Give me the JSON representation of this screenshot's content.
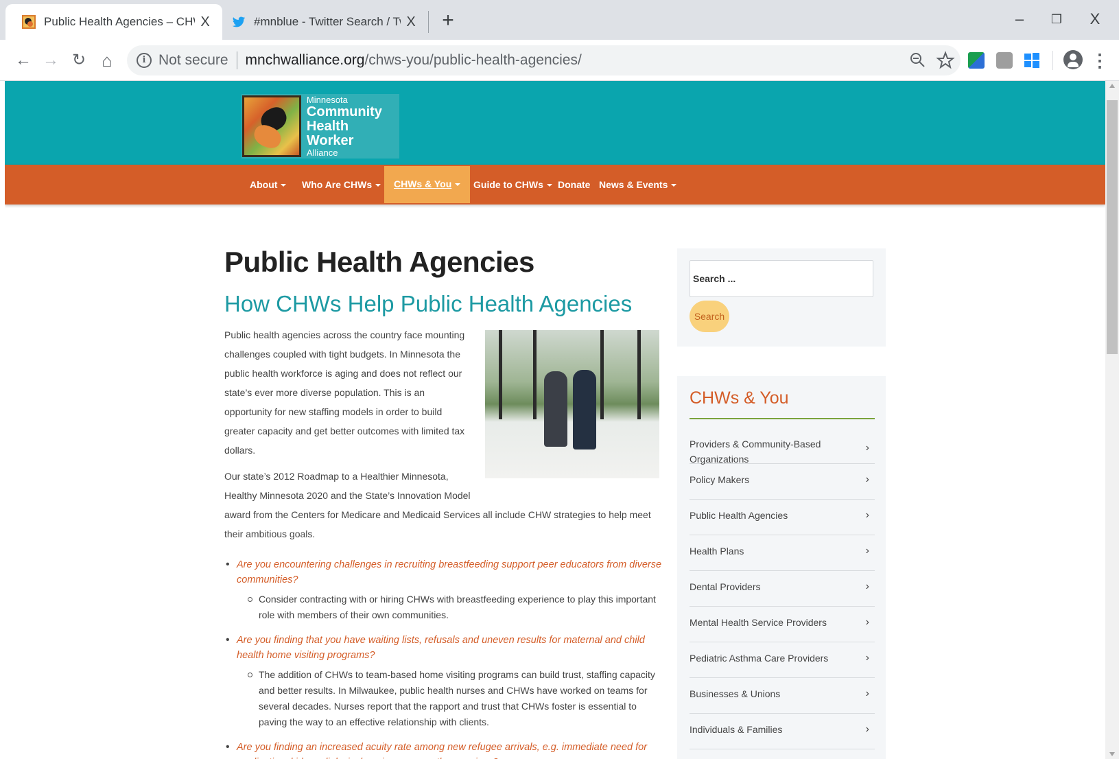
{
  "browser": {
    "tabs": [
      {
        "title": "Public Health Agencies – CHW",
        "close": "X"
      },
      {
        "title": "#mnblue - Twitter Search / Twitte",
        "close": "X"
      }
    ],
    "new_tab": "+",
    "window": {
      "minimize": "–",
      "restore": "❐",
      "close": "X"
    },
    "nav": {
      "back": "←",
      "forward": "→",
      "reload": "↻",
      "home": "⌂"
    },
    "address": {
      "security": "Not secure",
      "domain": "mnchwalliance.org",
      "path": "/chws-you/public-health-agencies/"
    },
    "icons": {
      "zoom": "zoom-out-icon",
      "bookmark": "star-icon",
      "menu": "⋮"
    }
  },
  "site": {
    "logo": {
      "line1": "Minnesota",
      "line2": "Community",
      "line3": "Health Worker",
      "line4": "Alliance"
    },
    "nav": [
      {
        "label": "About",
        "dropdown": true
      },
      {
        "label": "Who Are CHWs",
        "dropdown": true
      },
      {
        "label": "CHWs & You",
        "dropdown": true,
        "active": true
      },
      {
        "label": "Guide to CHWs",
        "dropdown": true
      },
      {
        "label": "Donate",
        "dropdown": false
      },
      {
        "label": "News & Events",
        "dropdown": true
      }
    ]
  },
  "main": {
    "title": "Public Health Agencies",
    "subtitle": "How CHWs Help Public Health Agencies",
    "para1": "Public health agencies across the country face mounting challenges coupled with tight budgets. In Minnesota the public health workforce is aging and does not reflect our state’s ever more diverse population. This is an opportunity for new staffing models in order to build greater capacity and get better outcomes with limited tax dollars.",
    "para2_a": "Our state’s 2012 Roadmap to a Healthier Minnesota, Healthy Minnesota 2020 and the State’s Innovation Model",
    "para2_b": "award from the Centers for Medicare and Medicaid Services all include CHW strategies to help meet their ambitious goals.",
    "questions": [
      {
        "q": "Are you encountering challenges in recruiting breastfeeding support peer educators from diverse communities?",
        "a": "Consider contracting with or hiring CHWs with breastfeeding experience to play this important role with members of their own communities."
      },
      {
        "q": "Are you finding that you have waiting lists, refusals and uneven results for maternal and child health home visiting programs?",
        "a": "The addition of CHWs to team-based home visiting programs can build trust, staffing capacity and better results. In Milwaukee, public health nurses and CHWs have worked on teams for several decades. Nurses report that the rapport and trust that CHWs foster is essential to paving the way to an effective relationship with clients."
      },
      {
        "q": "Are you finding an increased acuity rate among new refugee arrivals, e.g. immediate need for medication, kidney dialysis, hospice care or other services?",
        "a": ""
      }
    ]
  },
  "sidebar": {
    "search_placeholder": "Search ...",
    "search_button": "Search",
    "menu_title": "CHWs & You",
    "items": [
      "Providers & Community-Based Organizations",
      "Policy Makers",
      "Public Health Agencies",
      "Health Plans",
      "Dental Providers",
      "Mental Health Service Providers",
      "Pediatric Asthma Care Providers",
      "Businesses & Unions",
      "Individuals & Families"
    ],
    "chevron": "›"
  },
  "colors": {
    "header_teal": "#0aa5ae",
    "nav_orange": "#d45d28",
    "nav_active": "#f2a84f",
    "subtitle_teal": "#1d9aa3",
    "question_orange": "#d45d28",
    "menu_rule_green": "#7aa33c",
    "search_button_yellow": "#f9d17c"
  }
}
